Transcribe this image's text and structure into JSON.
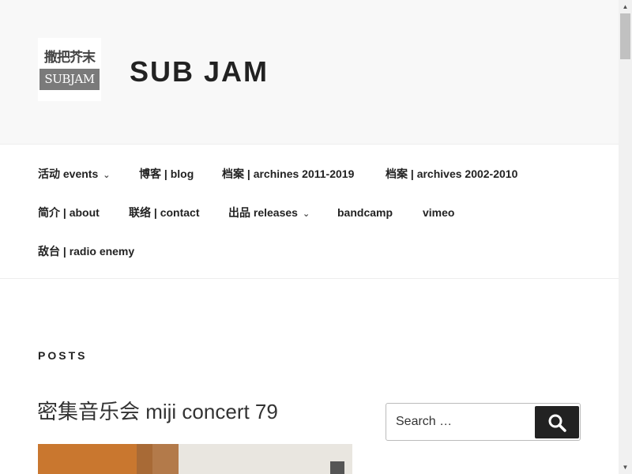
{
  "header": {
    "logo_top": "撒把芥末",
    "logo_bottom": "SUBJAM",
    "site_title": "SUB JAM"
  },
  "nav": {
    "items": [
      {
        "label": "活动 events",
        "has_submenu": true
      },
      {
        "label": "博客 | blog"
      },
      {
        "label": "档案 | archines 2011-2019"
      },
      {
        "label": "档案 | archives 2002-2010"
      },
      {
        "label": "简介 | about"
      },
      {
        "label": "联络 | contact"
      },
      {
        "label": "出品 releases",
        "has_submenu": true
      },
      {
        "label": "bandcamp"
      },
      {
        "label": "vimeo"
      },
      {
        "label": "敌台 | radio enemy"
      }
    ],
    "submenu_icon": "chevron-down-icon"
  },
  "main": {
    "posts_heading": "POSTS",
    "post_title": "密集音乐会 miji concert 79"
  },
  "search": {
    "placeholder": "Search …",
    "button_icon": "search-icon"
  },
  "colors": {
    "header_bg": "#f8f8f8",
    "text": "#222222",
    "button_bg": "#222222"
  }
}
